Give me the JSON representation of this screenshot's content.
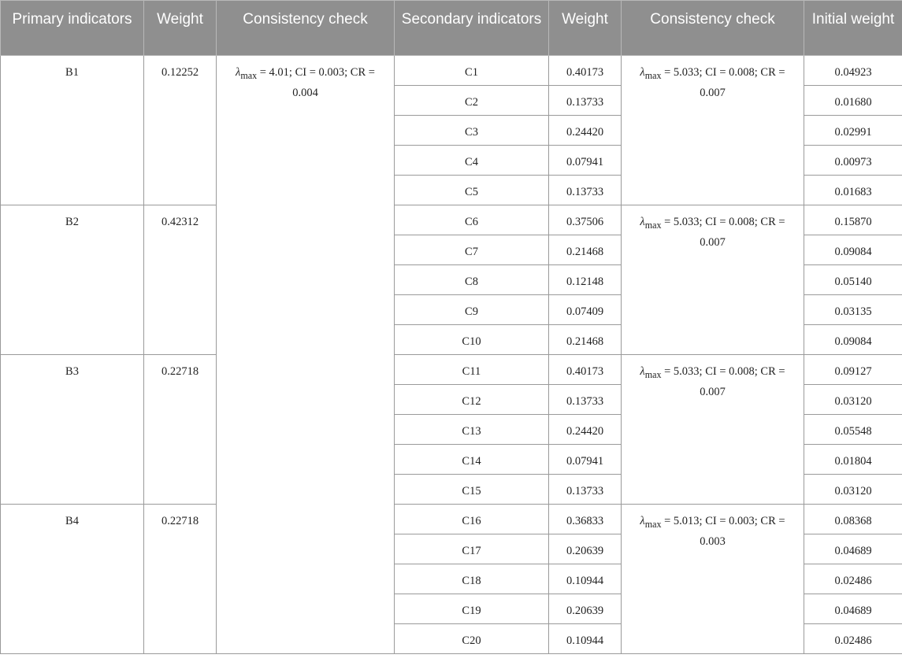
{
  "headers": {
    "primary": "Primary indicators",
    "weight1": "Weight",
    "check1": "Consistency check",
    "secondary": "Secondary indicators",
    "weight2": "Weight",
    "check2": "Consistency check",
    "initial": "Initial weight"
  },
  "lambda_symbol": "λ",
  "lambda_sub": "max",
  "primary_check_rest": " = 4.01; CI = 0.003; CR = 0.004",
  "groups": [
    {
      "primary": "B1",
      "weight": "0.12252",
      "check_rest": " = 5.033; CI = 0.008; CR = 0.007",
      "rows": [
        {
          "secondary": "C1",
          "weight": "0.40173",
          "initial": "0.04923"
        },
        {
          "secondary": "C2",
          "weight": "0.13733",
          "initial": "0.01680"
        },
        {
          "secondary": "C3",
          "weight": "0.24420",
          "initial": "0.02991"
        },
        {
          "secondary": "C4",
          "weight": "0.07941",
          "initial": "0.00973"
        },
        {
          "secondary": "C5",
          "weight": "0.13733",
          "initial": "0.01683"
        }
      ]
    },
    {
      "primary": "B2",
      "weight": "0.42312",
      "check_rest": " = 5.033; CI = 0.008; CR = 0.007",
      "rows": [
        {
          "secondary": "C6",
          "weight": "0.37506",
          "initial": "0.15870"
        },
        {
          "secondary": "C7",
          "weight": "0.21468",
          "initial": "0.09084"
        },
        {
          "secondary": "C8",
          "weight": "0.12148",
          "initial": "0.05140"
        },
        {
          "secondary": "C9",
          "weight": "0.07409",
          "initial": "0.03135"
        },
        {
          "secondary": "C10",
          "weight": "0.21468",
          "initial": "0.09084"
        }
      ]
    },
    {
      "primary": "B3",
      "weight": "0.22718",
      "check_rest": " = 5.033; CI = 0.008; CR = 0.007",
      "rows": [
        {
          "secondary": "C11",
          "weight": "0.40173",
          "initial": "0.09127"
        },
        {
          "secondary": "C12",
          "weight": "0.13733",
          "initial": "0.03120"
        },
        {
          "secondary": "C13",
          "weight": "0.24420",
          "initial": "0.05548"
        },
        {
          "secondary": "C14",
          "weight": "0.07941",
          "initial": "0.01804"
        },
        {
          "secondary": "C15",
          "weight": "0.13733",
          "initial": "0.03120"
        }
      ]
    },
    {
      "primary": "B4",
      "weight": "0.22718",
      "check_rest": " = 5.013; CI = 0.003; CR = 0.003",
      "rows": [
        {
          "secondary": "C16",
          "weight": "0.36833",
          "initial": "0.08368"
        },
        {
          "secondary": "C17",
          "weight": "0.20639",
          "initial": "0.04689"
        },
        {
          "secondary": "C18",
          "weight": "0.10944",
          "initial": "0.02486"
        },
        {
          "secondary": "C19",
          "weight": "0.20639",
          "initial": "0.04689"
        },
        {
          "secondary": "C20",
          "weight": "0.10944",
          "initial": "0.02486"
        }
      ]
    }
  ]
}
